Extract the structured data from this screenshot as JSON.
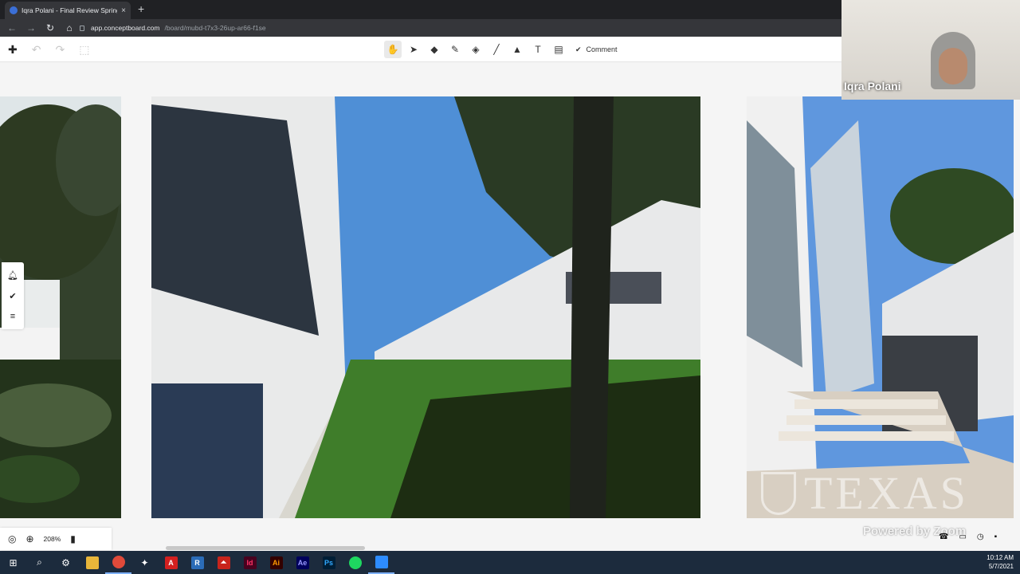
{
  "browser": {
    "tab_title": "Iqra Polani - Final Review Spring",
    "tab_close": "×",
    "new_tab": "+",
    "url_host": "app.conceptboard.com",
    "url_path": "/board/mubd-t7x3-26up-ar66-f1se"
  },
  "toolbar": {
    "comment_label": "Comment",
    "icons": [
      "hand-icon",
      "pointer-icon",
      "eraser-icon",
      "pen-icon",
      "marker-icon",
      "line-icon",
      "shapes-icon",
      "text-icon",
      "sticky-note-icon"
    ]
  },
  "zoom_widget": {
    "level": "208%"
  },
  "video": {
    "participant_name": "Iqra Polani"
  },
  "overlay": {
    "watermark": "TEXAS",
    "powered_by": "Powered by Zoom"
  },
  "taskbar": {
    "time": "10:12 AM",
    "date": "5/7/2021",
    "apps": [
      {
        "name": "acrobat",
        "label": "A",
        "color": "#d42020"
      },
      {
        "name": "revit",
        "label": "R",
        "color": "#2b6cb8"
      },
      {
        "name": "acrobat-reader",
        "label": "⏶",
        "color": "#c8241c"
      },
      {
        "name": "indesign",
        "label": "Id",
        "color": "#49021f"
      },
      {
        "name": "illustrator",
        "label": "Ai",
        "color": "#330000"
      },
      {
        "name": "after-effects",
        "label": "Ae",
        "color": "#00005b"
      },
      {
        "name": "photoshop",
        "label": "Ps",
        "color": "#001e36"
      }
    ]
  }
}
